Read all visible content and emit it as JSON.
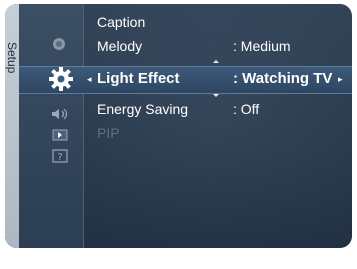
{
  "sidebar": {
    "title": "Setup",
    "icons": [
      "picture-icon",
      "setup-gear-icon",
      "sound-icon",
      "channel-icon",
      "support-icon"
    ]
  },
  "menu": {
    "items": [
      {
        "label": "Caption",
        "value": ""
      },
      {
        "label": "Melody",
        "value": ": Medium"
      },
      {
        "label": "Light Effect",
        "value": ": Watching TV",
        "selected": true
      },
      {
        "label": "Energy Saving",
        "value": ": Off"
      },
      {
        "label": "PIP",
        "value": "",
        "disabled": true
      }
    ]
  },
  "selection": {
    "left_arrow": "◂",
    "right_arrow": "▸"
  },
  "colors": {
    "panel": "#2b3d52",
    "highlight": "#3e5a7a",
    "strip": "#b7c0cb",
    "disabled_text": "#5f7088"
  }
}
